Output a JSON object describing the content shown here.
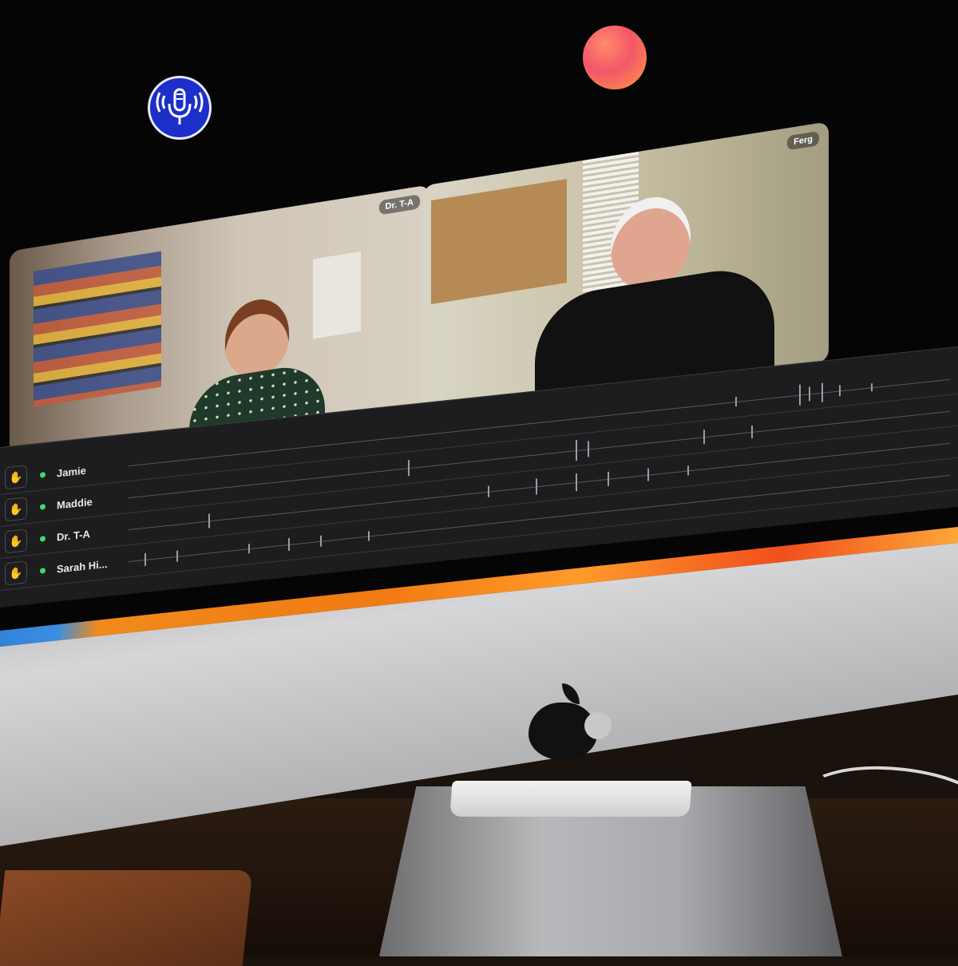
{
  "app": {
    "podcast_icon": "microphone-icon",
    "accent": "#1c2fc8",
    "status_orb_colors": [
      "#f4566a",
      "#ff9b3d"
    ]
  },
  "participants": [
    {
      "badge": "Dr. T-A"
    },
    {
      "badge": "Ferg"
    }
  ],
  "tracks": [
    {
      "name": "Jamie",
      "status_color": "#3ddc6a"
    },
    {
      "name": "Maddie",
      "status_color": "#3ddc6a"
    },
    {
      "name": "Dr. T-A",
      "status_color": "#3ddc6a"
    },
    {
      "name": "Sarah Hi...",
      "status_color": "#3ddc6a"
    }
  ],
  "track_icon": "raise-hand-icon",
  "device": {
    "logo": "apple-logo-icon"
  }
}
